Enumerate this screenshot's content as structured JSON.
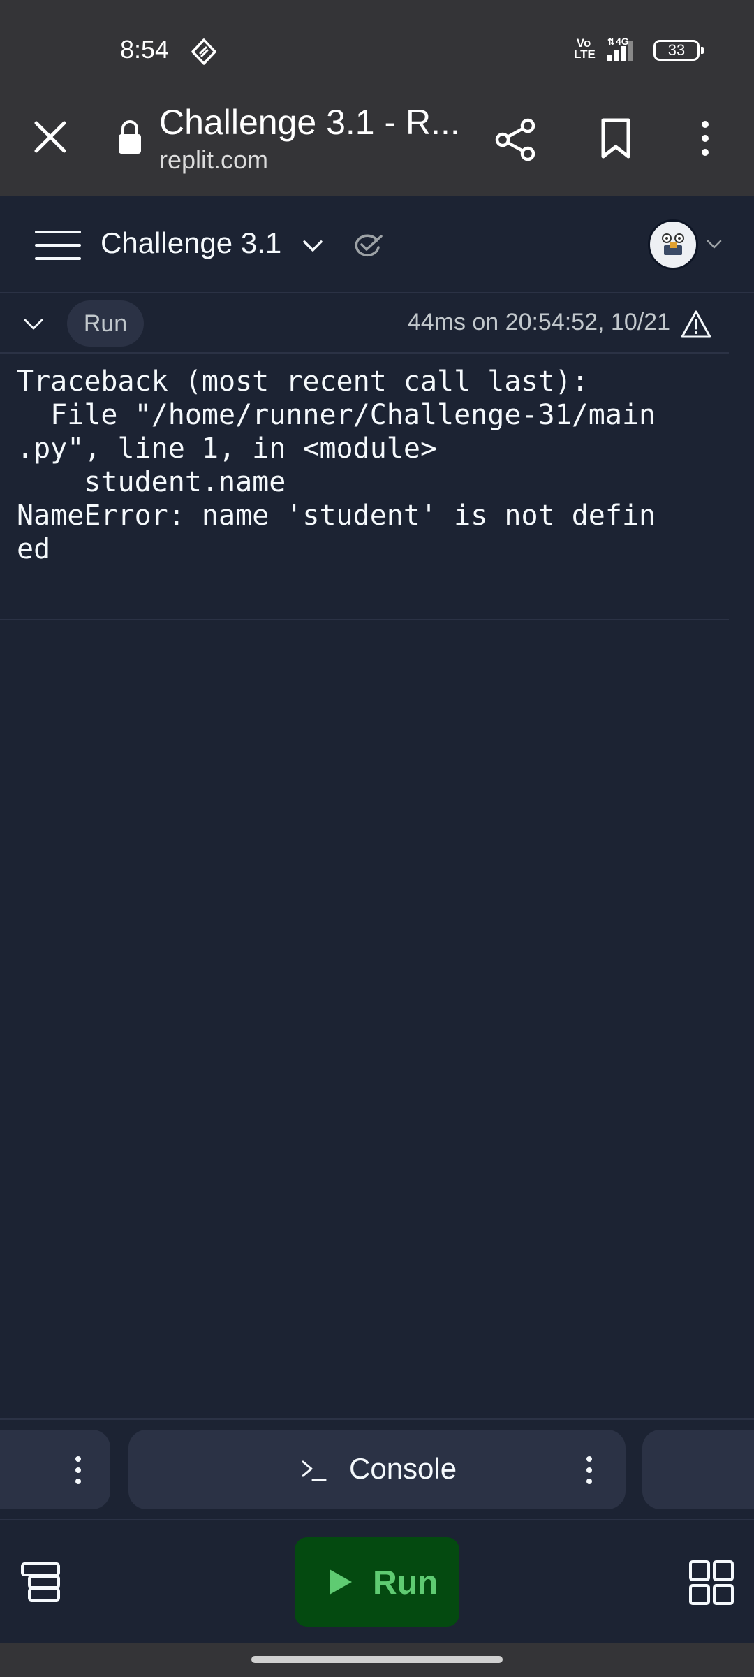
{
  "status_bar": {
    "time": "8:54",
    "network_label": "Vo LTE",
    "network_type": "4G",
    "battery": "33"
  },
  "browser": {
    "title": "Challenge 3.1 - R...",
    "url": "replit.com"
  },
  "app_header": {
    "repl_name": "Challenge 3.1"
  },
  "console": {
    "run_chip": "Run",
    "timing": "44ms on 20:54:52, 10/21",
    "output_lines": [
      "Traceback (most recent call last):",
      "  File \"/home/runner/Challenge-31/main",
      ".py\", line 1, in <module>",
      "    student.name",
      "NameError: name 'student' is not defin",
      "ed"
    ]
  },
  "tabs": {
    "console_label": "Console"
  },
  "toolbar": {
    "run_label": "Run"
  },
  "colors": {
    "background": "#1c2333",
    "surface": "#2b3245",
    "browser_chrome": "#343437",
    "run_button_bg": "#044a10",
    "run_button_fg": "#5fcb72"
  }
}
